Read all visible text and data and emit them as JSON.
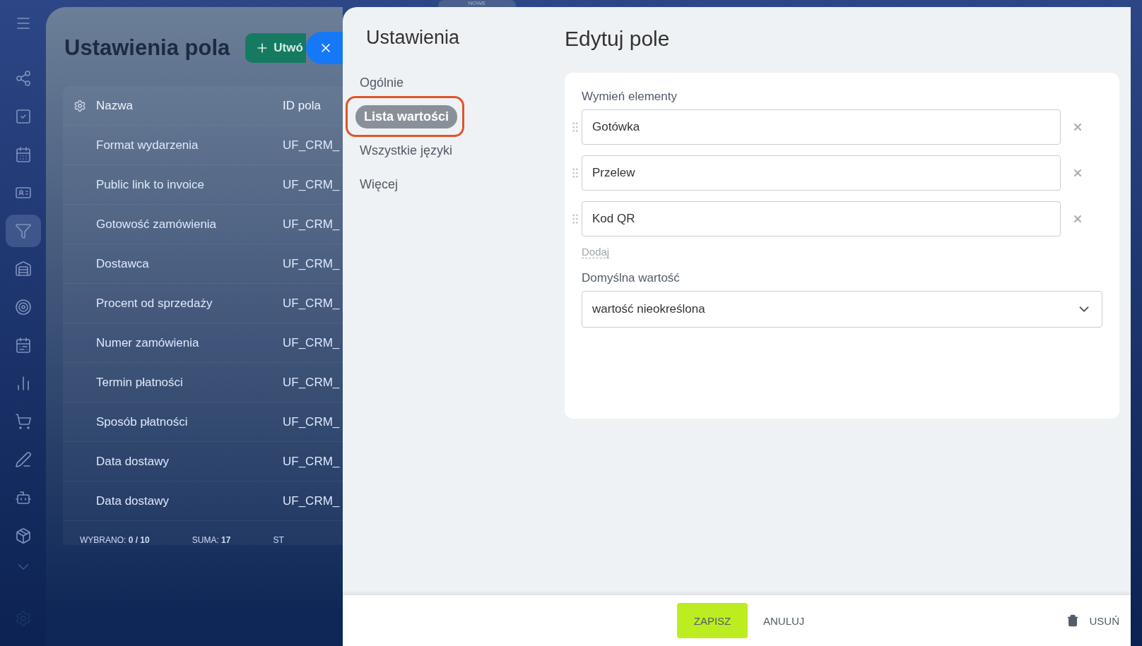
{
  "sidebar": {
    "items": [
      {
        "selected": false
      },
      {
        "selected": false
      },
      {
        "selected": false
      },
      {
        "selected": false
      },
      {
        "selected": false
      },
      {
        "selected": true
      },
      {
        "selected": false
      },
      {
        "selected": false
      },
      {
        "selected": false
      },
      {
        "selected": false
      },
      {
        "selected": false
      },
      {
        "selected": false
      },
      {
        "selected": false
      },
      {
        "selected": false
      }
    ]
  },
  "page": {
    "title": "Ustawienia pola",
    "create_button": "Utwó",
    "top_tab": "NOWE",
    "table": {
      "columns": [
        "Nazwa",
        "ID pola"
      ],
      "rows": [
        {
          "name": "Format wydarzenia",
          "id": "UF_CRM_"
        },
        {
          "name": "Public link to invoice",
          "id": "UF_CRM_"
        },
        {
          "name": "Gotowość zamówienia",
          "id": "UF_CRM_"
        },
        {
          "name": "Dostawca",
          "id": "UF_CRM_"
        },
        {
          "name": "Procent od sprzedaży",
          "id": "UF_CRM_"
        },
        {
          "name": "Numer zamówienia",
          "id": "UF_CRM_"
        },
        {
          "name": "Termin płatności",
          "id": "UF_CRM_"
        },
        {
          "name": "Sposób płatności",
          "id": "UF_CRM_"
        },
        {
          "name": "Data dostawy",
          "id": "UF_CRM_"
        },
        {
          "name": "Data dostawy",
          "id": "UF_CRM_"
        }
      ],
      "footer": [
        {
          "label": "WYBRANO:",
          "value": "0 / 10"
        },
        {
          "label": "SUMA:",
          "value": "17"
        },
        {
          "label": "ST"
        }
      ]
    }
  },
  "settings": {
    "title": "Ustawienia",
    "nav": [
      {
        "label": "Ogólnie",
        "selected": false,
        "highlighted": false
      },
      {
        "label": "Lista wartości",
        "selected": true,
        "highlighted": true
      },
      {
        "label": "Wszystkie języki",
        "selected": false,
        "highlighted": false
      },
      {
        "label": "Więcej",
        "selected": false,
        "highlighted": false
      }
    ]
  },
  "editor": {
    "title": "Edytuj pole",
    "items_label": "Wymień elementy",
    "items": [
      "Gotówka",
      "Przelew",
      "Kod QR"
    ],
    "add_link": "Dodaj",
    "default_label": "Domyślna wartość",
    "default_value": "wartość nieokreślona"
  },
  "footer": {
    "save": "ZAPISZ",
    "cancel": "ANULUJ",
    "delete": "USUŃ"
  }
}
